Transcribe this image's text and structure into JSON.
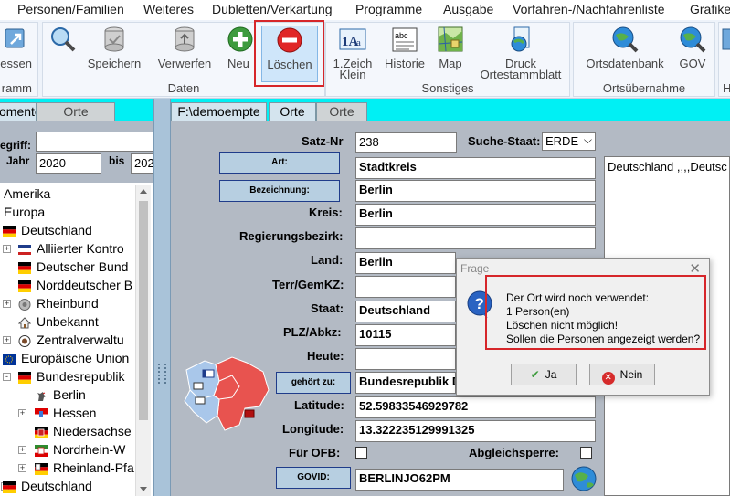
{
  "menu": [
    "Personen/Familien",
    "Weiteres",
    "Dubletten/Verkartung",
    "Programme",
    "Ausgabe",
    "Vorfahren-/Nachfahrenliste",
    "Grafike"
  ],
  "ribbon": {
    "partial_button": "essen",
    "partial_group": "ramm",
    "daten": {
      "label": "Daten",
      "buttons": [
        {
          "label": "Speichern",
          "icon": "database-icon"
        },
        {
          "label": "Verwerfen",
          "icon": "database-discard-icon"
        },
        {
          "label": "Neu",
          "icon": "add-icon"
        },
        {
          "label": "Löschen",
          "icon": "delete-icon"
        }
      ]
    },
    "sonstiges": {
      "label": "Sonstiges",
      "buttons": [
        {
          "label": "1.Zeich Klein",
          "icon": "font-icon"
        },
        {
          "label": "Historie",
          "icon": "history-icon"
        },
        {
          "label": "Map",
          "icon": "map-icon"
        },
        {
          "label": "Druck Ortestammblatt",
          "icon": "print-icon"
        }
      ]
    },
    "ortsuebernahme": {
      "label": "Ortsübernahme",
      "buttons": [
        {
          "label": "Ortsdatenbank",
          "icon": "globe-search-icon"
        },
        {
          "label": "GOV",
          "icon": "globe-search-icon"
        }
      ]
    },
    "partial_right": "H"
  },
  "tabs_left": [
    {
      "label": "omente"
    },
    {
      "label": "Orte"
    }
  ],
  "tabs_right": [
    {
      "label": "F:\\demoempte"
    },
    {
      "label": "Orte"
    },
    {
      "label": "Orte"
    }
  ],
  "filter": {
    "begriff_label": "egriff:",
    "begriff_value": "",
    "jahr_label": "Jahr",
    "jahr_value": "2020",
    "bis_label": "bis",
    "bis_value": "202"
  },
  "tree": [
    {
      "label": "Amerika",
      "indent": 0,
      "expander": "",
      "icon": ""
    },
    {
      "label": "Europa",
      "indent": 0,
      "expander": "",
      "icon": ""
    },
    {
      "label": "Deutschland",
      "indent": 0,
      "expander": "",
      "icon": "flag-germany-icon"
    },
    {
      "label": "Alliierter Kontro",
      "indent": 1,
      "expander": "+",
      "icon": "flag-allied-icon"
    },
    {
      "label": "Deutscher Bund",
      "indent": 1,
      "expander": "",
      "icon": "flag-germany-icon"
    },
    {
      "label": "Norddeutscher B",
      "indent": 1,
      "expander": "",
      "icon": "flag-germany-icon"
    },
    {
      "label": "Rheinbund",
      "indent": 1,
      "expander": "+",
      "icon": "crest-icon"
    },
    {
      "label": "Unbekannt",
      "indent": 1,
      "expander": "",
      "icon": "house-icon"
    },
    {
      "label": "Zentralverwaltu",
      "indent": 1,
      "expander": "+",
      "icon": "seal-icon"
    },
    {
      "label": "Europäische Union",
      "indent": 0,
      "expander": "",
      "icon": "flag-eu-icon"
    },
    {
      "label": "Bundesrepublik",
      "indent": 1,
      "expander": "-",
      "icon": "flag-germany-icon"
    },
    {
      "label": "Berlin",
      "indent": 2,
      "expander": "",
      "icon": "bear-icon"
    },
    {
      "label": "Hessen",
      "indent": 2,
      "expander": "+",
      "icon": "flag-hessen-icon"
    },
    {
      "label": "Niedersachse",
      "indent": 2,
      "expander": "",
      "icon": "flag-niedersachsen-icon"
    },
    {
      "label": "Nordrhein-W",
      "indent": 2,
      "expander": "+",
      "icon": "flag-nrw-icon"
    },
    {
      "label": "Rheinland-Pfa",
      "indent": 2,
      "expander": "+",
      "icon": "flag-rlp-icon"
    },
    {
      "label": "Deutschland",
      "indent": 0,
      "expander": "+",
      "icon": "flag-germany-icon"
    }
  ],
  "form": {
    "satz_nr_label": "Satz-Nr",
    "satz_nr": "238",
    "such_staat_label": "Suche-Staat:",
    "such_staat": "ERDE",
    "art_button": "Art:",
    "art": "Stadtkreis",
    "bezeichnung_button": "Bezeichnung:",
    "bezeichnung": "Berlin",
    "kreis_label": "Kreis:",
    "kreis": "Berlin",
    "regierungsbezirk_label": "Regierungsbezirk:",
    "regierungsbezirk": "",
    "land_label": "Land:",
    "land": "Berlin",
    "terr_label": "Terr/GemKZ:",
    "terr": "",
    "staat_label": "Staat:",
    "staat": "Deutschland",
    "plz_label": "PLZ/Abkz:",
    "plz": "10115",
    "heute_label": "Heute:",
    "heute": "",
    "gehoert_zu_button": "gehört zu:",
    "gehoert_zu": "Bundesrepublik D",
    "latitude_label": "Latitude:",
    "latitude": "52.59833546929782",
    "longitude_label": "Longitude:",
    "longitude": "13.322235129991325",
    "fuer_ofb_label": "Für OFB:",
    "abgleichsperre_label": "Abgleichsperre:",
    "govid_button": "GOVID:",
    "govid": "BERLINJO62PM",
    "memo": "Deutschland ,,,,Deutsc"
  },
  "dialog": {
    "title": "Frage",
    "lines": [
      "Der Ort wird noch verwendet:",
      "1 Person(en)",
      "Löschen nicht möglich!",
      "Sollen die Personen angezeigt werden?"
    ],
    "yes": "Ja",
    "no": "Nein"
  },
  "colors": {
    "accent_cyan": "#00f0f4",
    "highlight_red": "#d6262a",
    "form_bg": "#b3bac4",
    "berlin_map_red": "#e8534f",
    "berlin_map_blue": "#a9c7ea"
  }
}
